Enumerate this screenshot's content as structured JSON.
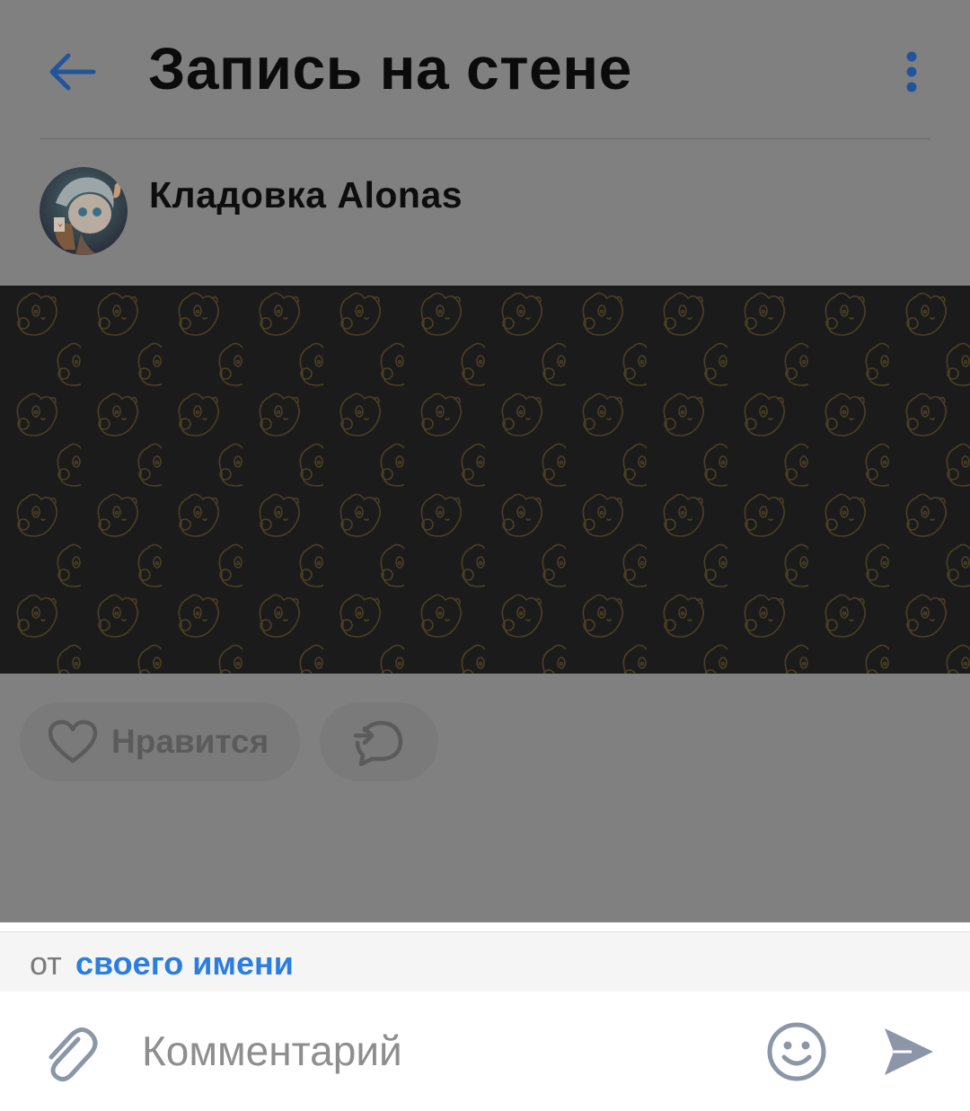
{
  "header": {
    "title": "Запись на стене",
    "back_icon": "arrow-left-icon",
    "more_icon": "more-vertical-icon",
    "accent": "#2b63b0"
  },
  "post": {
    "author_name": "Кладовка Alonas",
    "avatar": "avatar",
    "banner_color": "#1b1b1b",
    "pattern_color": "#4a3f24"
  },
  "actions": {
    "like_label": "Нравится",
    "like_icon": "heart-icon",
    "share_icon": "share-icon"
  },
  "composer": {
    "as_prefix": "от",
    "as_link": "своего имени",
    "placeholder": "Комментарий",
    "attach_icon": "paperclip-icon",
    "emoji_icon": "smiley-icon",
    "send_icon": "send-icon",
    "link_color": "#2b7de0"
  }
}
